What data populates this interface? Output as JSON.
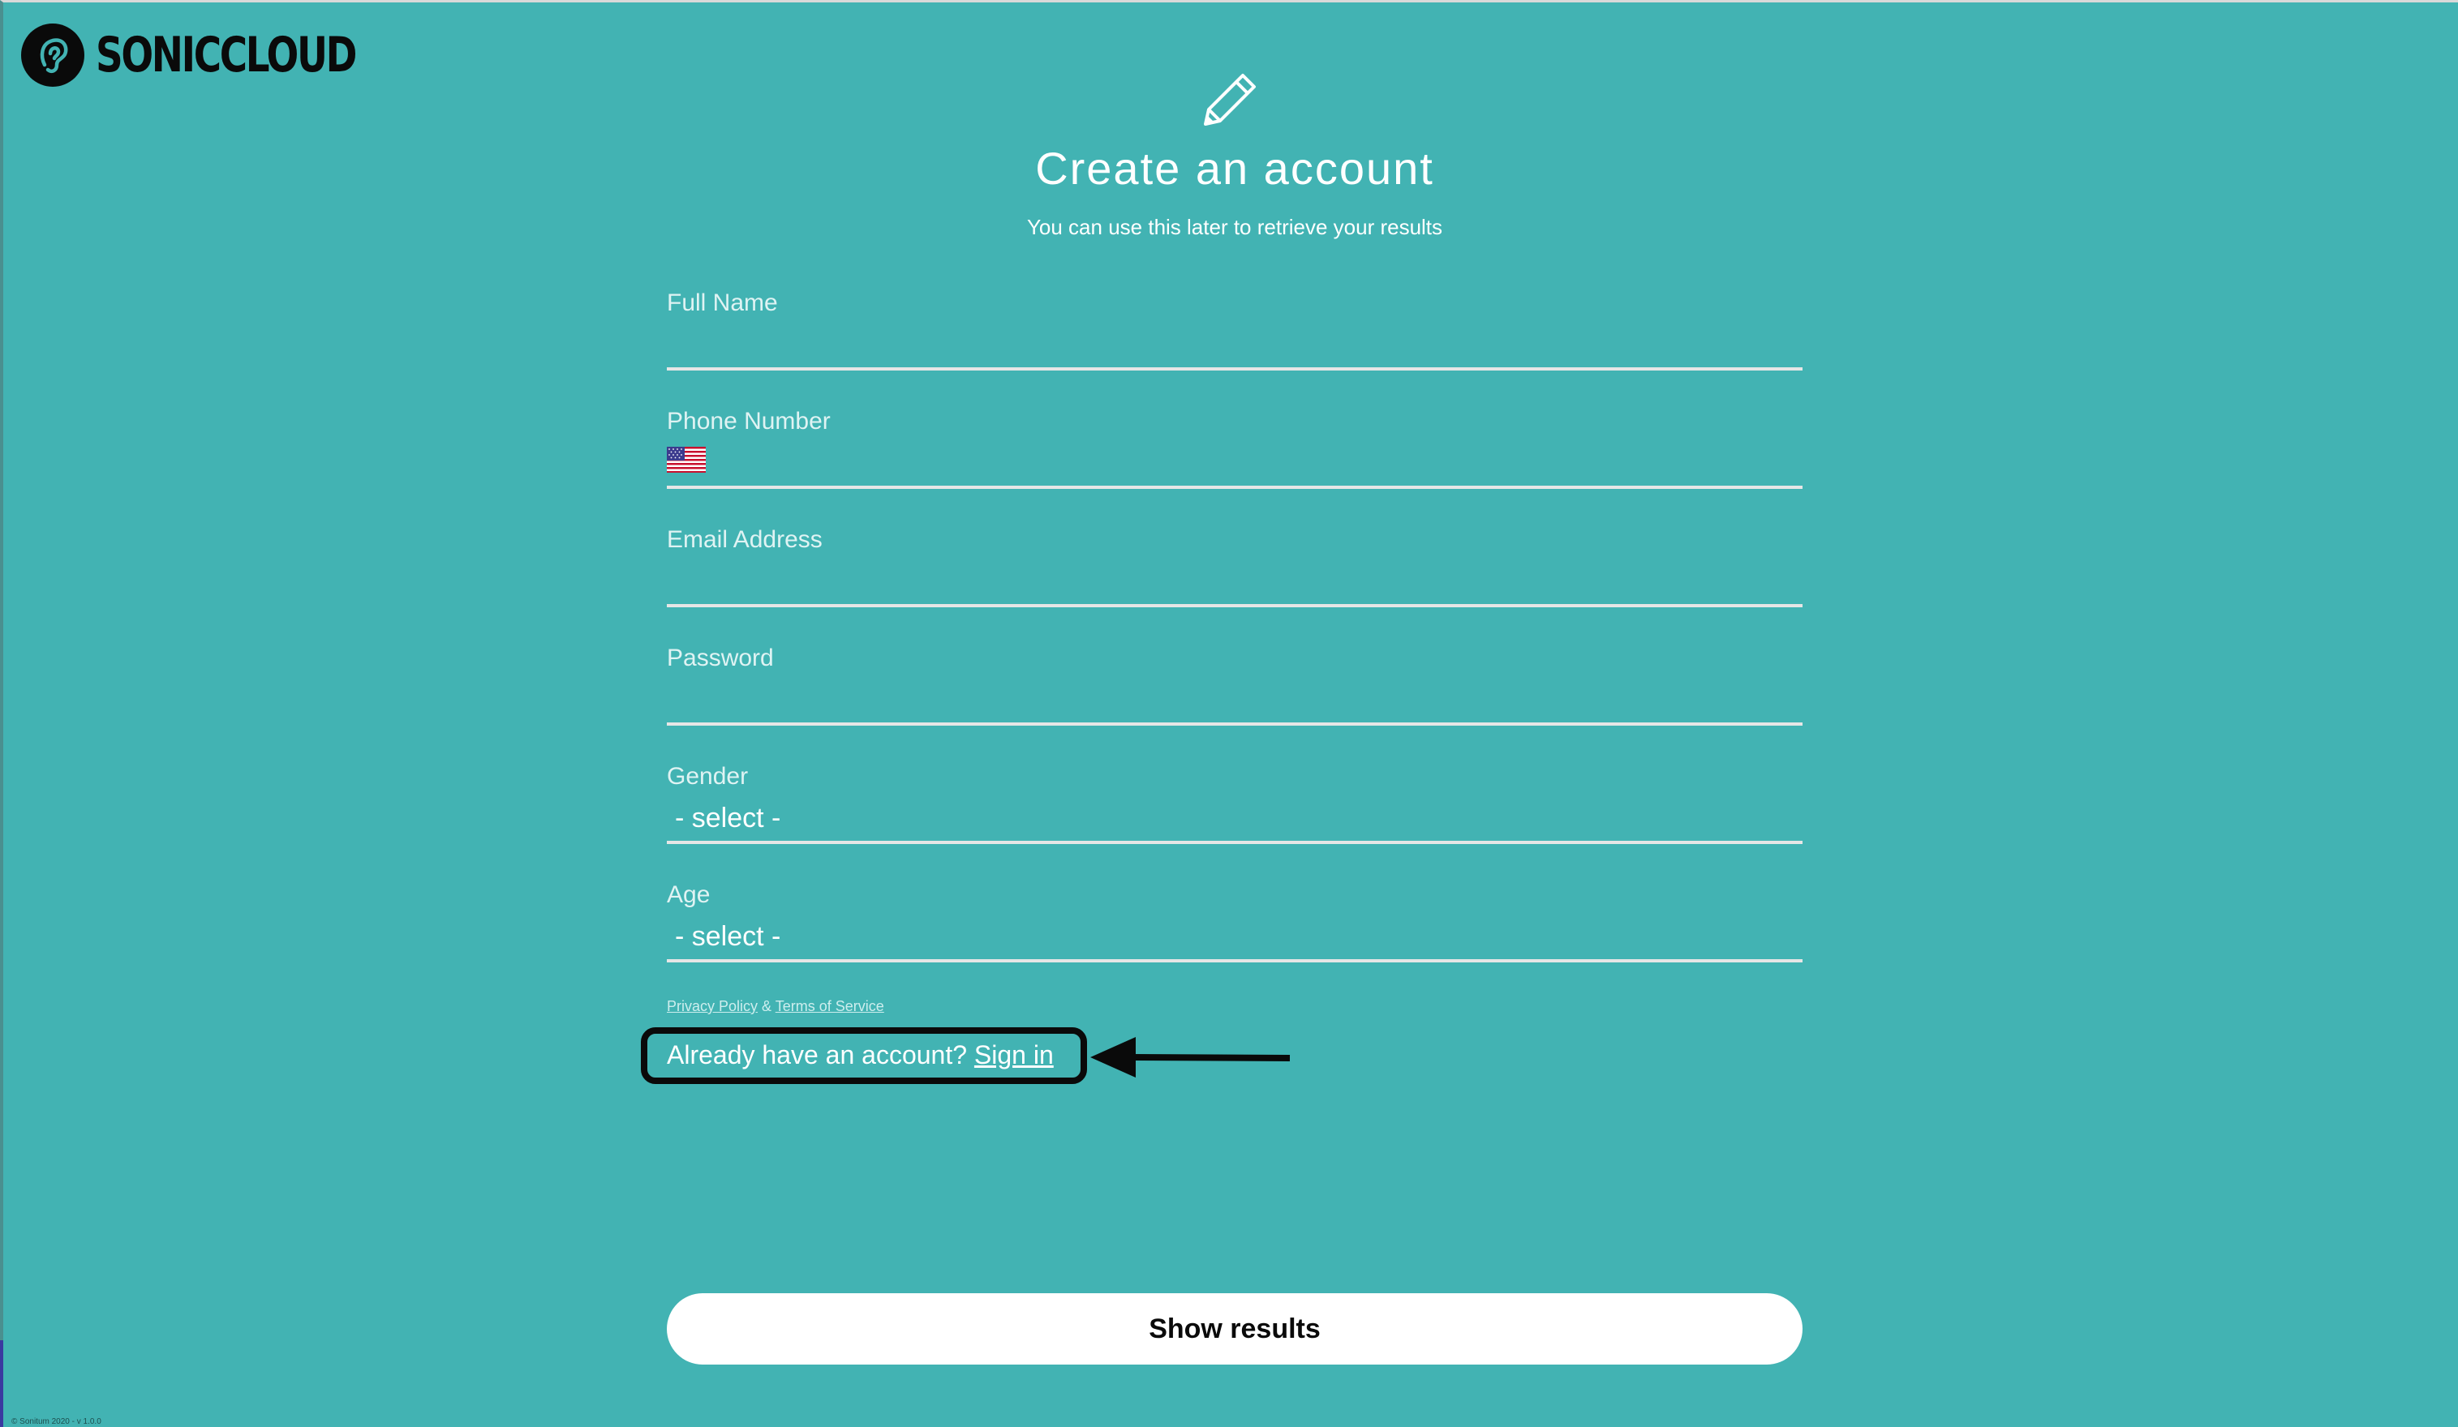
{
  "brand": {
    "name": "SONICCLOUD",
    "logo_icon": "ear-icon"
  },
  "header": {
    "icon": "pencil-icon",
    "title": "Create an account",
    "subtitle": "You can use this later to retrieve your results"
  },
  "form": {
    "full_name": {
      "label": "Full Name",
      "value": ""
    },
    "phone": {
      "label": "Phone Number",
      "value": "",
      "flag_icon": "us-flag-icon"
    },
    "email": {
      "label": "Email Address",
      "value": ""
    },
    "password": {
      "label": "Password",
      "value": ""
    },
    "gender": {
      "label": "Gender",
      "selected": "- select -"
    },
    "age": {
      "label": "Age",
      "selected": "- select -"
    }
  },
  "legal": {
    "privacy": "Privacy Policy",
    "separator": "&",
    "terms": "Terms of Service"
  },
  "signin": {
    "prompt": "Already have an account?",
    "link": "Sign in"
  },
  "submit_label": "Show results",
  "footer": "© Sonitum 2020 - v 1.0.0",
  "colors": {
    "background": "#42b3b3",
    "text": "#ffffff",
    "annotation": "#0a0a0a"
  }
}
